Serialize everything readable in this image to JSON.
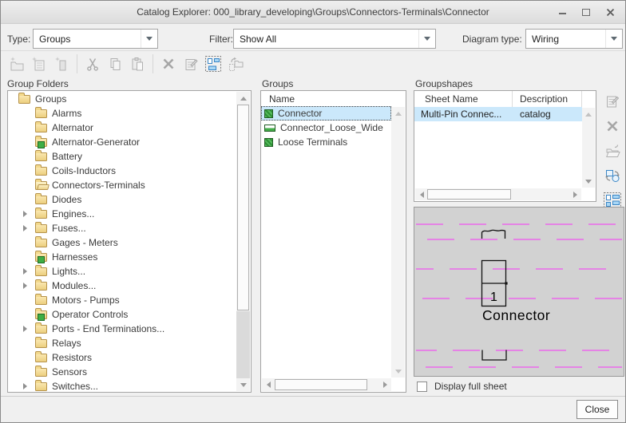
{
  "window": {
    "title": "Catalog Explorer: 000_library_developing\\Groups\\Connectors-Terminals\\Connector"
  },
  "header": {
    "type_label": "Type:",
    "type_value": "Groups",
    "filter_label": "Filter:",
    "filter_value": "Show All",
    "diagram_type_label": "Diagram type:",
    "diagram_type_value": "Wiring"
  },
  "toolbar": {
    "icons": [
      "new-folder",
      "new-group",
      "new-groupshape",
      "cut",
      "copy",
      "paste",
      "delete",
      "edit-properties",
      "display-groupshapes",
      "move-group"
    ]
  },
  "group_folders": {
    "label": "Group Folders",
    "items": [
      {
        "label": "Groups",
        "icon": "folder",
        "depth": 0,
        "expander": false
      },
      {
        "label": "Alarms",
        "icon": "folder",
        "depth": 1,
        "expander": false
      },
      {
        "label": "Alternator",
        "icon": "folder",
        "depth": 1,
        "expander": false
      },
      {
        "label": "Alternator-Generator",
        "icon": "folder-badge",
        "depth": 1,
        "expander": false
      },
      {
        "label": "Battery",
        "icon": "folder",
        "depth": 1,
        "expander": false
      },
      {
        "label": "Coils-Inductors",
        "icon": "folder",
        "depth": 1,
        "expander": false
      },
      {
        "label": "Connectors-Terminals",
        "icon": "folder-open",
        "depth": 1,
        "expander": false
      },
      {
        "label": "Diodes",
        "icon": "folder",
        "depth": 1,
        "expander": false
      },
      {
        "label": "Engines...",
        "icon": "folder",
        "depth": 1,
        "expander": true
      },
      {
        "label": "Fuses...",
        "icon": "folder",
        "depth": 1,
        "expander": true
      },
      {
        "label": "Gages - Meters",
        "icon": "folder",
        "depth": 1,
        "expander": false
      },
      {
        "label": "Harnesses",
        "icon": "folder-badge",
        "depth": 1,
        "expander": false
      },
      {
        "label": "Lights...",
        "icon": "folder",
        "depth": 1,
        "expander": true
      },
      {
        "label": "Modules...",
        "icon": "folder",
        "depth": 1,
        "expander": true
      },
      {
        "label": "Motors - Pumps",
        "icon": "folder",
        "depth": 1,
        "expander": false
      },
      {
        "label": "Operator Controls",
        "icon": "folder-badge",
        "depth": 1,
        "expander": false
      },
      {
        "label": "Ports - End Terminations...",
        "icon": "folder",
        "depth": 1,
        "expander": true
      },
      {
        "label": "Relays",
        "icon": "folder",
        "depth": 1,
        "expander": false
      },
      {
        "label": "Resistors",
        "icon": "folder",
        "depth": 1,
        "expander": false
      },
      {
        "label": "Sensors",
        "icon": "folder",
        "depth": 1,
        "expander": false
      },
      {
        "label": "Switches...",
        "icon": "folder",
        "depth": 1,
        "expander": true
      }
    ]
  },
  "groups": {
    "label": "Groups",
    "column_name": "Name",
    "selected": "Connector",
    "items": [
      {
        "name": "Connector",
        "icon": "group-square",
        "selected": true
      },
      {
        "name": "Connector_Loose_Wide",
        "icon": "group-wide",
        "selected": false
      },
      {
        "name": "Loose Terminals",
        "icon": "group-square",
        "selected": false
      }
    ]
  },
  "groupshapes": {
    "label": "Groupshapes",
    "columns": [
      "Sheet Name",
      "Description"
    ],
    "rows": [
      {
        "sheet_name": "Multi-Pin Connec...",
        "description": "catalog",
        "selected": true
      }
    ],
    "side_icons": [
      "edit-properties",
      "delete",
      "open-groupshape",
      "replace-groupshape",
      "select-groupshapes"
    ]
  },
  "preview": {
    "symbol_label": "Connector",
    "pin_number": "1",
    "background_color": "#d2d2d2",
    "wire_color": "#e583e5"
  },
  "footer": {
    "display_full_sheet": "Display full sheet",
    "display_full_sheet_checked": false,
    "close": "Close"
  }
}
